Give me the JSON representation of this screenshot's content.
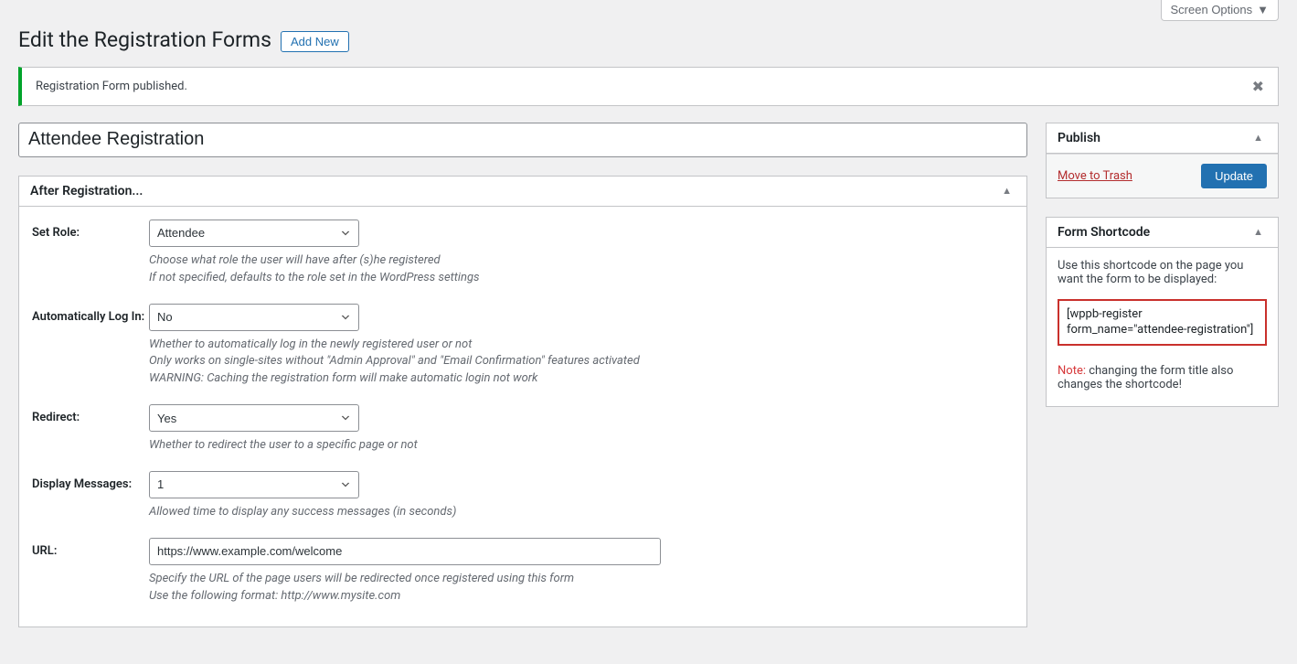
{
  "screen_options": "Screen Options",
  "header": {
    "title": "Edit the Registration Forms",
    "add_new": "Add New"
  },
  "notice": {
    "message": "Registration Form published."
  },
  "title_input": {
    "value": "Attendee Registration"
  },
  "metabox": {
    "title": "After Registration...",
    "fields": {
      "set_role": {
        "label": "Set Role:",
        "value": "Attendee",
        "desc1": "Choose what role the user will have after (s)he registered",
        "desc2": "If not specified, defaults to the role set in the WordPress settings"
      },
      "auto_login": {
        "label": "Automatically Log In:",
        "value": "No",
        "desc1": "Whether to automatically log in the newly registered user or not",
        "desc2": "Only works on single-sites without \"Admin Approval\" and \"Email Confirmation\" features activated",
        "desc3": "WARNING: Caching the registration form will make automatic login not work"
      },
      "redirect": {
        "label": "Redirect:",
        "value": "Yes",
        "desc1": "Whether to redirect the user to a specific page or not"
      },
      "display_messages": {
        "label": "Display Messages:",
        "value": "1",
        "desc1": "Allowed time to display any success messages (in seconds)"
      },
      "url": {
        "label": "URL:",
        "value": "https://www.example.com/welcome",
        "desc1": "Specify the URL of the page users will be redirected once registered using this form",
        "desc2": "Use the following format: http://www.mysite.com"
      }
    }
  },
  "publish": {
    "title": "Publish",
    "trash": "Move to Trash",
    "update": "Update"
  },
  "shortcode": {
    "title": "Form Shortcode",
    "intro": "Use this shortcode on the page you want the form to be displayed:",
    "code": "[wppb-register form_name=\"attendee-registration\"]",
    "note_label": "Note:",
    "note_text": " changing the form title also changes the shortcode!"
  }
}
